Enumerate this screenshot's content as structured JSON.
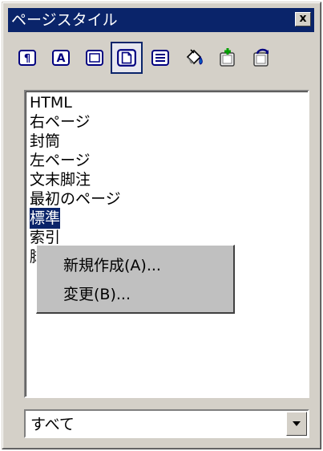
{
  "window": {
    "title": "ページスタイル",
    "close_glyph": "x"
  },
  "toolbar": {
    "buttons": [
      {
        "name": "paragraph-styles-icon"
      },
      {
        "name": "character-styles-icon"
      },
      {
        "name": "frame-styles-icon"
      },
      {
        "name": "page-styles-icon",
        "active": true
      },
      {
        "name": "list-styles-icon"
      },
      {
        "name": "fill-format-mode-icon"
      },
      {
        "name": "new-style-from-selection-icon"
      },
      {
        "name": "update-style-icon"
      }
    ]
  },
  "styles_list": {
    "items": [
      "HTML",
      "右ページ",
      "封筒",
      "左ページ",
      "文末脚注",
      "最初のページ",
      "標準",
      "索引",
      "脚注"
    ],
    "selected": "標準"
  },
  "context_menu": {
    "items": [
      {
        "label": "新規作成(A)..."
      },
      {
        "label": "変更(B)..."
      }
    ]
  },
  "filter": {
    "value": "すべて"
  },
  "colors": {
    "titlebar": "#0a246a",
    "face": "#d4d0c8",
    "selection": "#0a246a"
  }
}
